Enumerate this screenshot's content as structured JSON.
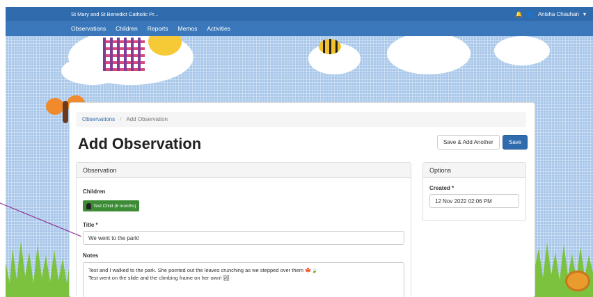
{
  "nav": {
    "school_name": "St Mary and St Benedict Catholic Pr...",
    "user_name": "Anisha Chauhan",
    "menu": [
      "Observations",
      "Children",
      "Reports",
      "Memos",
      "Activities"
    ]
  },
  "breadcrumb": {
    "parent": "Observations",
    "separator": "/",
    "current": "Add Observation"
  },
  "page": {
    "title": "Add Observation"
  },
  "actions": {
    "save_add_another": "Save & Add Another",
    "save": "Save"
  },
  "observation": {
    "heading": "Observation",
    "children_label": "Children",
    "child_chip": "Test Child (6 months)",
    "title_label": "Title *",
    "title_value": "We went to the park!",
    "notes_label": "Notes",
    "notes_line1": "Test and I walked to the park. She pointed out the leaves crunching as we stepped over them 🍁🍃",
    "notes_line2": "Test went on the slide and the climbing frame on her own! 🏞"
  },
  "options": {
    "heading": "Options",
    "created_label": "Created *",
    "created_value": "12 Nov 2022 02:06 PM"
  },
  "colors": {
    "nav": "#2f6bad",
    "chip": "#3c8b35",
    "primary": "#2f6bad"
  },
  "icons": [
    "bell-icon",
    "user-icon",
    "caret-down-icon",
    "child-avatar-icon"
  ]
}
